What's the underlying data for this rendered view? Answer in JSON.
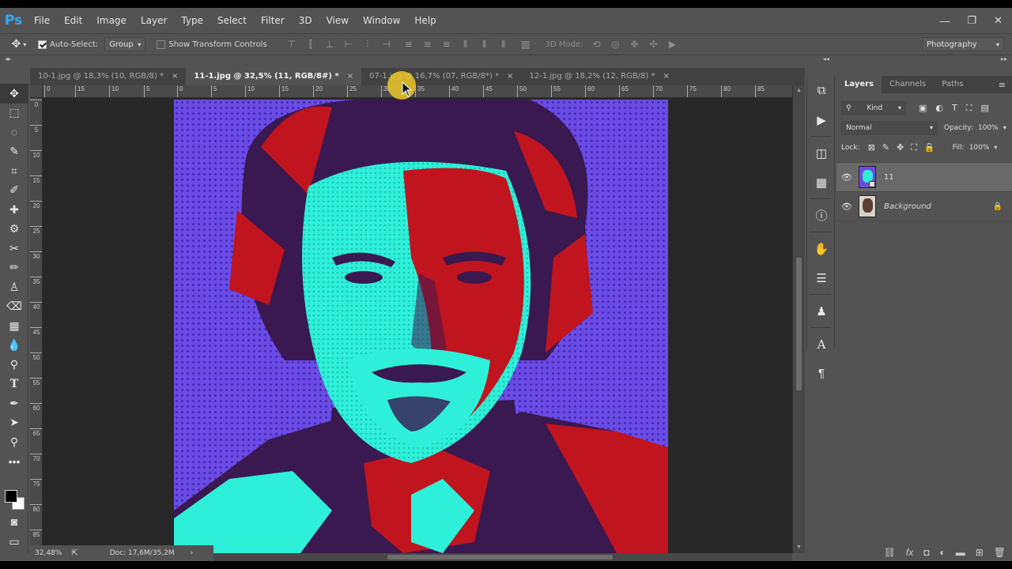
{
  "app": {
    "logo": "Ps"
  },
  "menu": [
    "File",
    "Edit",
    "Image",
    "Layer",
    "Type",
    "Select",
    "Filter",
    "3D",
    "View",
    "Window",
    "Help"
  ],
  "window_controls": [
    "—",
    "❐",
    "✕"
  ],
  "options": {
    "auto_select_label": "Auto-Select:",
    "auto_select_checked": true,
    "auto_select_target": "Group",
    "show_transform_label": "Show Transform Controls",
    "mode_3d_label": "3D Mode:",
    "workspace": "Photography"
  },
  "tabs": [
    {
      "label": "10-1.jpg @ 18,3% (10, RGB/8) *",
      "close": "×"
    },
    {
      "label": "11-1.jpg @ 32,5% (11, RGB/8#) *",
      "close": "×"
    },
    {
      "label": "07-1.jpg @ 16,7% (07, RGB/8*) *",
      "close": "×"
    },
    {
      "label": "12-1.jpg @ 18,2% (12, RGB/8) *",
      "close": "×"
    }
  ],
  "ruler_top_ticks": [
    "0",
    "15",
    "10",
    "5",
    "0",
    "5",
    "10",
    "15",
    "20",
    "25",
    "30",
    "35",
    "40",
    "45",
    "50",
    "55",
    "60",
    "65",
    "70",
    "75",
    "80",
    "85"
  ],
  "ruler_left_ticks": [
    "0",
    "5",
    "10",
    "15",
    "20",
    "25",
    "30",
    "35",
    "40",
    "45",
    "50",
    "55",
    "60",
    "65",
    "70",
    "75",
    "80",
    "85"
  ],
  "status": {
    "zoom": "32,48%",
    "doc": "Doc: 17,6M/35,2M"
  },
  "layers_panel": {
    "tabs": [
      "Layers",
      "Channels",
      "Paths"
    ],
    "kind_label": "Kind",
    "blend_mode": "Normal",
    "opacity_label": "Opacity:",
    "opacity": "100%",
    "lock_label": "Lock:",
    "fill_label": "Fill:",
    "fill": "100%",
    "layers": [
      {
        "name": "11",
        "selected": true
      },
      {
        "name": "Background",
        "locked": true
      }
    ]
  },
  "colors": {
    "ui_bg": "#535353",
    "canvas_bg": "#282828",
    "art_blue": "#6b4be6",
    "art_red": "#c0141e",
    "art_cyan": "#2ef0d8",
    "art_purple": "#3a1850"
  }
}
